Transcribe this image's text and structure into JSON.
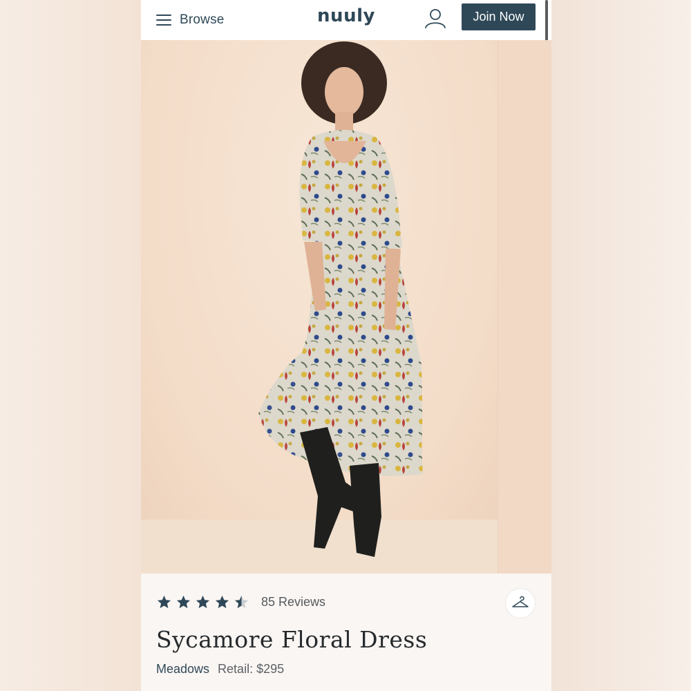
{
  "header": {
    "browse_label": "Browse",
    "logo": "nuuly",
    "join_label": "Join Now",
    "icons": [
      "hamburger-menu-icon",
      "user-account-icon"
    ]
  },
  "hero": {
    "image": "model-in-floral-midi-dress-and-black-cowboy-boots"
  },
  "product": {
    "rating_stars": 4.5,
    "rating_max": 5,
    "reviews_label": "85 Reviews",
    "title": "Sycamore Floral Dress",
    "brand": "Meadows",
    "retail_label": "Retail: $295",
    "icons": [
      "hanger-icon"
    ]
  },
  "colors": {
    "brand_navy": "#2f4858",
    "star_empty": "#c9ced2",
    "background": "#faf6f3"
  }
}
